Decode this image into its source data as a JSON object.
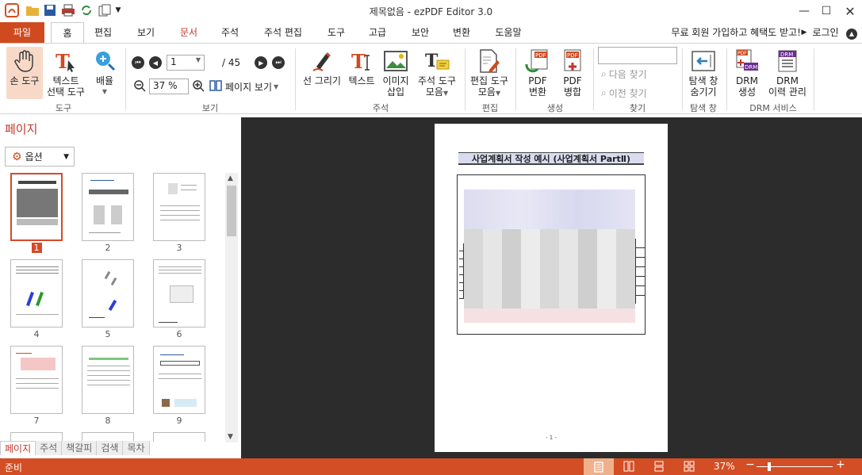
{
  "app": {
    "title": "제목없음 - ezPDF Editor 3.0",
    "accent": "#d34e24"
  },
  "tabs": {
    "file": "파일",
    "items": [
      "홈",
      "편집",
      "보기",
      "문서",
      "주석",
      "주석 편집",
      "도구",
      "고급",
      "보안",
      "변환",
      "도움말"
    ],
    "promo": "무료 회원 가입하고 혜택도 받고!",
    "login": "로그인"
  },
  "ribbon": {
    "hand_tool": "손 도구",
    "text_select_1": "텍스트",
    "text_select_2": "선택 도구",
    "zoom_1": "배율",
    "group_tools": "도구",
    "page_input": "1",
    "page_total": "/ 45",
    "zoom_value": "37 %",
    "page_view": "페이지 보기",
    "group_view": "보기",
    "draw_line": "선 그리기",
    "text": "텍스트",
    "image_1": "이미지",
    "image_2": "삽입",
    "annot_1": "주석 도구",
    "annot_2": "모음",
    "group_annot": "주석",
    "edit_1": "편집 도구",
    "edit_2": "모음",
    "group_edit": "편집",
    "pdf_convert_1": "PDF",
    "pdf_convert_2": "변환",
    "pdf_merge_1": "PDF",
    "pdf_merge_2": "병합",
    "group_create": "생성",
    "find_next": "다음 찾기",
    "find_prev": "이전 찾기",
    "group_find": "찾기",
    "nav_1": "탐색 창",
    "nav_2": "숨기기",
    "group_nav": "탐색 창",
    "drm_create_1": "DRM",
    "drm_create_2": "생성",
    "drm_hist_1": "DRM",
    "drm_hist_2": "이력 관리",
    "group_drm": "DRM 서비스"
  },
  "panel": {
    "title": "페이지",
    "options": "옵션",
    "thumbnails": [
      "1",
      "2",
      "3",
      "4",
      "5",
      "6",
      "7",
      "8",
      "9"
    ],
    "bottom_tabs": [
      "페이지",
      "주석",
      "책갈피",
      "검색",
      "목차"
    ]
  },
  "document": {
    "heading": "사업계획서 작성 예시 (사업계획서 PartⅡ)",
    "footer": "- 1 -"
  },
  "status": {
    "ready": "준비",
    "zoom": "37%"
  }
}
